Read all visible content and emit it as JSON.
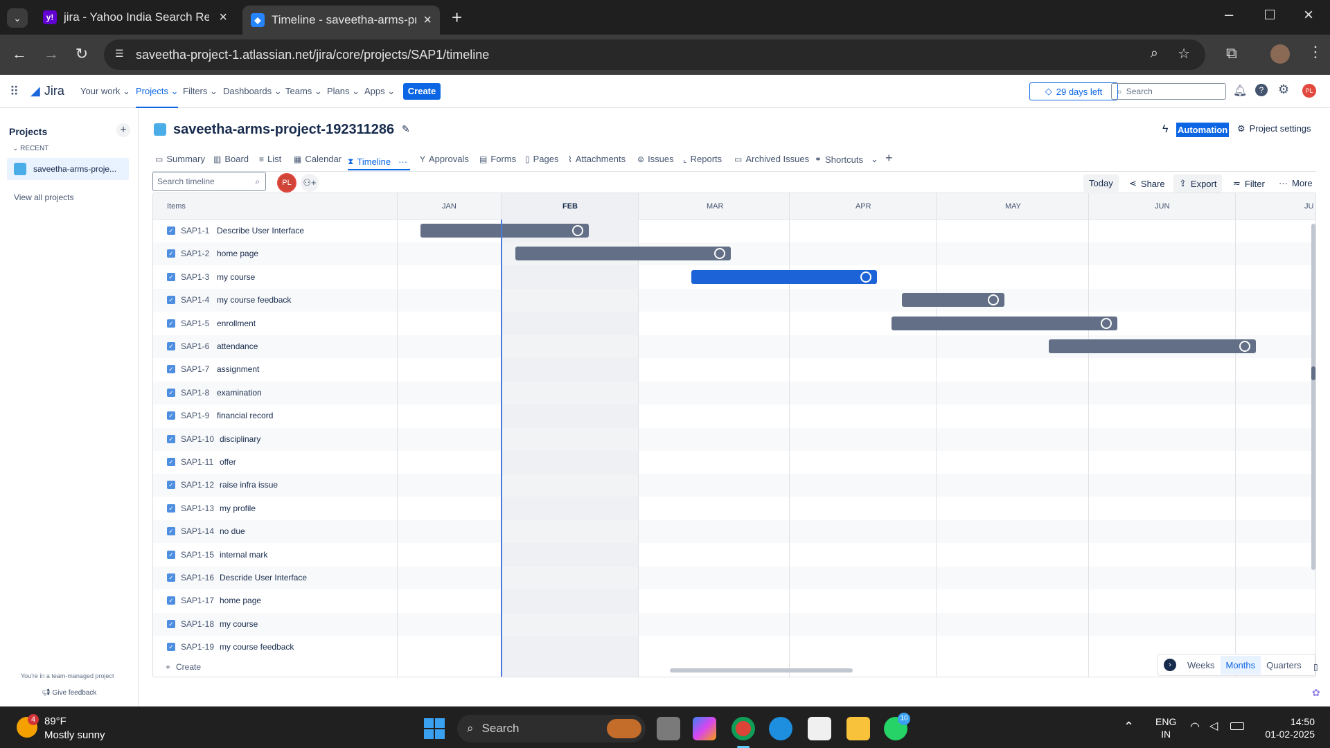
{
  "browser": {
    "tabs": [
      {
        "title": "jira - Yahoo India Search Results"
      },
      {
        "title": "Timeline - saveetha-arms-proje"
      }
    ],
    "url": "saveetha-project-1.atlassian.net/jira/core/projects/SAP1/timeline"
  },
  "jira": {
    "logo": "Jira",
    "nav": [
      "Your work",
      "Projects",
      "Filters",
      "Dashboards",
      "Teams",
      "Plans",
      "Apps"
    ],
    "create": "Create",
    "trial": "29 days left",
    "search_placeholder": "Search",
    "user_initials": "PL"
  },
  "sidebar": {
    "title": "Projects",
    "recent": "RECENT",
    "project": "saveetha-arms-proje...",
    "view_all": "View all projects",
    "team_note": "You're in a team-managed project",
    "feedback": "Give feedback"
  },
  "project": {
    "name": "saveetha-arms-project-192311286",
    "automation": "Automation",
    "settings": "Project settings",
    "tabs": [
      "Summary",
      "Board",
      "List",
      "Calendar",
      "Timeline",
      "Approvals",
      "Forms",
      "Pages",
      "Attachments",
      "Issues",
      "Reports",
      "Archived Issues",
      "Shortcuts"
    ]
  },
  "toolbar": {
    "search_placeholder": "Search timeline",
    "avatar": "PL",
    "today": "Today",
    "share": "Share",
    "export": "Export",
    "filter": "Filter",
    "more": "More"
  },
  "timeline": {
    "items_header": "Items",
    "months": [
      "JAN",
      "FEB",
      "MAR",
      "APR",
      "MAY",
      "JUN",
      "JU"
    ],
    "create": "Create",
    "rows": [
      {
        "key": "SAP1-1",
        "title": "Describe User Interface",
        "bar": {
          "start": "2025-01-08",
          "end": "2025-02-19",
          "selected": false
        }
      },
      {
        "key": "SAP1-2",
        "title": "home page",
        "bar": {
          "start": "2025-02-04",
          "end": "2025-03-20",
          "selected": false
        }
      },
      {
        "key": "SAP1-3",
        "title": "my course",
        "bar": {
          "start": "2025-03-12",
          "end": "2025-04-19",
          "selected": true
        }
      },
      {
        "key": "SAP1-4",
        "title": "my course feedback",
        "bar": {
          "start": "2025-04-24",
          "end": "2025-05-15",
          "selected": false
        }
      },
      {
        "key": "SAP1-5",
        "title": "enrollment",
        "bar": {
          "start": "2025-04-22",
          "end": "2025-06-07",
          "selected": false
        }
      },
      {
        "key": "SAP1-6",
        "title": "attendance",
        "bar": {
          "start": "2025-05-24",
          "end": "2025-07-09",
          "selected": false
        }
      },
      {
        "key": "SAP1-7",
        "title": "assignment"
      },
      {
        "key": "SAP1-8",
        "title": "examination"
      },
      {
        "key": "SAP1-9",
        "title": "financial record"
      },
      {
        "key": "SAP1-10",
        "title": "disciplinary"
      },
      {
        "key": "SAP1-11",
        "title": "offer"
      },
      {
        "key": "SAP1-12",
        "title": "raise infra issue"
      },
      {
        "key": "SAP1-13",
        "title": "my profile"
      },
      {
        "key": "SAP1-14",
        "title": "no due"
      },
      {
        "key": "SAP1-15",
        "title": "internal mark"
      },
      {
        "key": "SAP1-16",
        "title": "Descride User Interface"
      },
      {
        "key": "SAP1-17",
        "title": "home page"
      },
      {
        "key": "SAP1-18",
        "title": "my course"
      },
      {
        "key": "SAP1-19",
        "title": "my course feedback"
      }
    ],
    "zoom": [
      "Weeks",
      "Months",
      "Quarters"
    ],
    "zoom_selected": "Months"
  },
  "taskbar": {
    "weather_temp": "89°F",
    "weather_desc": "Mostly sunny",
    "weather_badge": "4",
    "search": "Search",
    "lang1": "ENG",
    "lang2": "IN",
    "time": "14:50",
    "date": "01-02-2025",
    "whatsapp_badge": "10"
  }
}
